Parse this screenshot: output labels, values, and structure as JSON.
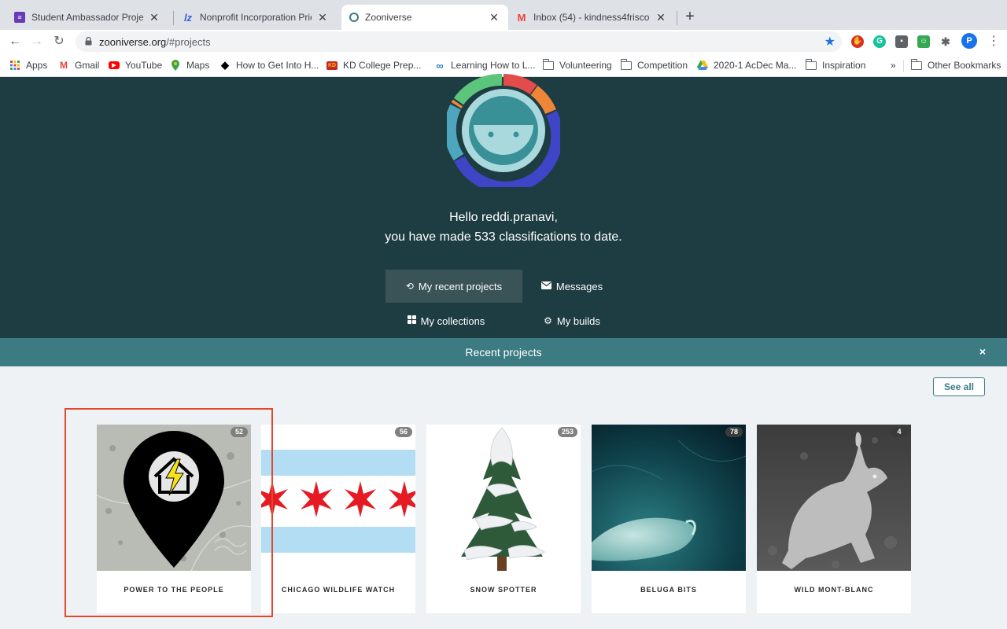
{
  "browser": {
    "tabs": [
      {
        "title": "Student Ambassador Project A",
        "icon": "forms-icon",
        "color": "#673ab7"
      },
      {
        "title": "Nonprofit Incorporation Pricing",
        "icon": "iz-icon",
        "color": "#3b5bdb"
      },
      {
        "title": "Zooniverse",
        "icon": "zooniverse-icon",
        "color": "#3d7b83"
      },
      {
        "title": "Inbox (54) - kindness4frisco@",
        "icon": "gmail-icon",
        "color": "#ea4335"
      }
    ],
    "url": {
      "host": "zooniverse.org",
      "path": "/#projects"
    },
    "profile_initial": "P",
    "bookmarks": [
      {
        "label": "Apps",
        "icon": "apps-grid-icon"
      },
      {
        "label": "Gmail",
        "icon": "gmail-icon"
      },
      {
        "label": "YouTube",
        "icon": "youtube-icon"
      },
      {
        "label": "Maps",
        "icon": "maps-pin-icon"
      },
      {
        "label": "How to Get Into H...",
        "icon": "grad-cap-icon"
      },
      {
        "label": "KD College Prep...",
        "icon": "kd-icon"
      },
      {
        "label": "Learning How to L...",
        "icon": "coursera-icon"
      },
      {
        "label": "Volunteering",
        "icon": "folder-icon"
      },
      {
        "label": "Competition",
        "icon": "folder-icon"
      },
      {
        "label": "2020-1 AcDec Ma...",
        "icon": "drive-icon"
      },
      {
        "label": "Inspiration",
        "icon": "folder-icon"
      },
      {
        "label": "Other Bookmarks",
        "icon": "folder-icon"
      }
    ],
    "overflow": "»"
  },
  "hero": {
    "greeting_line1": "Hello reddi.pranavi,",
    "greeting_line2": "you have made 533 classifications to date.",
    "buttons": {
      "recent": "My recent projects",
      "messages": "Messages",
      "collections": "My collections",
      "builds": "My builds"
    }
  },
  "recent": {
    "title": "Recent projects",
    "close": "×",
    "see_all": "See all",
    "projects": [
      {
        "name": "POWER TO THE PEOPLE",
        "count": "52"
      },
      {
        "name": "CHICAGO WILDLIFE WATCH",
        "count": "56"
      },
      {
        "name": "SNOW SPOTTER",
        "count": "253"
      },
      {
        "name": "BELUGA BITS",
        "count": "78"
      },
      {
        "name": "WILD MONT-BLANC",
        "count": "4"
      }
    ]
  },
  "colors": {
    "hero_bg": "#1e3d42",
    "accent": "#3d7b83",
    "highlight": "#e3482c"
  }
}
